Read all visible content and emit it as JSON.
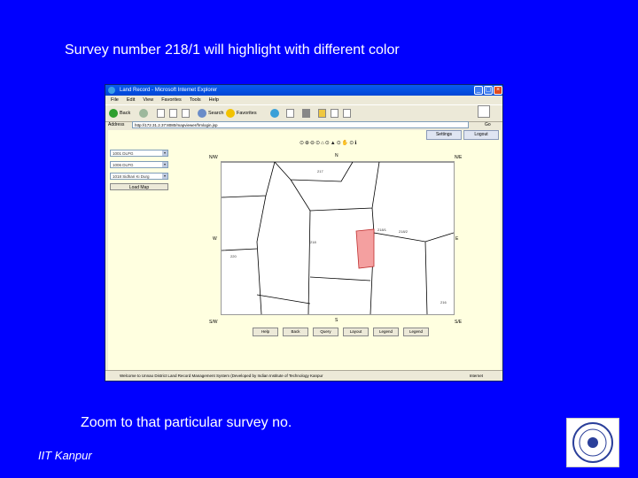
{
  "slide": {
    "title": "Survey number 218/1 will highlight with different color",
    "caption": "Zoom to that particular survey no.",
    "footer": "IIT Kanpur",
    "logo_icon": "institute-seal-icon"
  },
  "browser": {
    "window_title": "Land Record - Microsoft Internet Explorer",
    "menu": [
      "File",
      "Edit",
      "View",
      "Favorites",
      "Tools",
      "Help"
    ],
    "toolbar": {
      "back": "Back",
      "search": "Search",
      "favorites": "Favorites"
    },
    "address_label": "Address",
    "address_value": "http://172.31.2.37:8080/mapviewer/frmlogin.jsp",
    "go_label": "Go",
    "status_text": "Welcome to Unnao District Land Record Management System (Developed by Indian Institute of Technology Kanpur",
    "status_zone": "Internet"
  },
  "app": {
    "tabs": [
      "Settings",
      "Logout"
    ],
    "selects": [
      "1001 DLPG",
      "1006 DLPG",
      "1018 Sidhari Ki Durg"
    ],
    "load_button": "Load Map",
    "map_tools": "⊙⊕⊖⊙⌂⊙▲⊙✋⊙ℹ",
    "directions": {
      "nw": "N/W",
      "n": "N",
      "ne": "N/E",
      "w": "W",
      "e": "E",
      "sw": "S/W",
      "s": "S",
      "se": "S/E"
    },
    "parcel_labels": [
      "218",
      "218/1",
      "217",
      "218/2",
      "216",
      "220"
    ],
    "action_buttons": [
      "Help",
      "Back",
      "Query",
      "Layout",
      "Legend",
      "Legend"
    ],
    "highlight_color": "#f4a0a0"
  }
}
